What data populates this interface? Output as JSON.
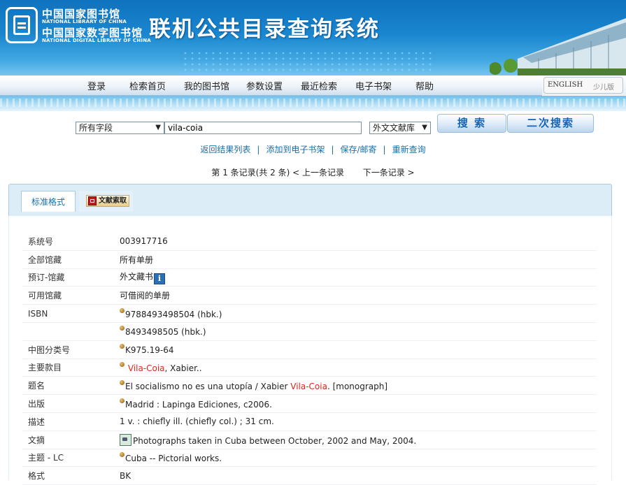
{
  "header": {
    "logo_cn_1": "中国国家图书馆",
    "logo_en_1": "NATIONAL LIBRARY OF CHINA",
    "logo_cn_2": "中国国家数字图书馆",
    "logo_en_2": "NATIONAL DIGITAL LIBRARY OF CHINA",
    "system_title": "联机公共目录查询系统"
  },
  "nav": {
    "items": [
      "登录",
      "检索首页",
      "我的图书馆",
      "参数设置",
      "最近检索",
      "电子书架",
      "帮助"
    ],
    "lang_english": "ENGLISH",
    "lang_kids": "少儿版"
  },
  "search": {
    "field_select": "所有字段",
    "query": "vila-coia",
    "library_select": "外文文献库",
    "search_button": "搜 索",
    "refine_button": "二次搜索"
  },
  "links": [
    "返回结果列表",
    "添加到电子书架",
    "保存/邮寄",
    "重新查询"
  ],
  "record_nav": {
    "position": "第 1 条记录(共 2 条)",
    "prev": "< 上一条记录",
    "next": "下一条记录 >"
  },
  "tabs": {
    "standard": "标准格式",
    "document_request": "文献索取"
  },
  "record": {
    "sysno_label": "系统号",
    "sysno": "003917716",
    "holdings_label": "全部馆藏",
    "holdings": "所有单册",
    "reserve_label": "预订-馆藏",
    "reserve": "外文藏书",
    "available_label": "可用馆藏",
    "available": "可借阅的单册",
    "isbn_label": "ISBN",
    "isbn_1": "9788493498504 (hbk.)",
    "isbn_2": "8493498505 (hbk.)",
    "class_label": "中图分类号",
    "class": "K975.19-64",
    "author_label": "主要款目",
    "author_hl": "Vila-Coia",
    "author_rest": ", Xabier..",
    "title_label": "题名",
    "title_pre": "El socialismo no es una utopía / Xabier ",
    "title_hl": "Vila-Coia",
    "title_post": ". [monograph]",
    "pub_label": "出版",
    "pub": "Madrid : Lapinga Ediciones, c2006.",
    "desc_label": "描述",
    "desc": "1 v. : chiefly ill. (chiefly col.) ; 31 cm.",
    "abstract_label": "文摘",
    "abstract": "Photographs taken in Cuba between October, 2002 and May, 2004.",
    "subject_label": "主题 - LC",
    "subject": "Cuba -- Pictorial works.",
    "format_label": "格式",
    "format": "BK"
  }
}
